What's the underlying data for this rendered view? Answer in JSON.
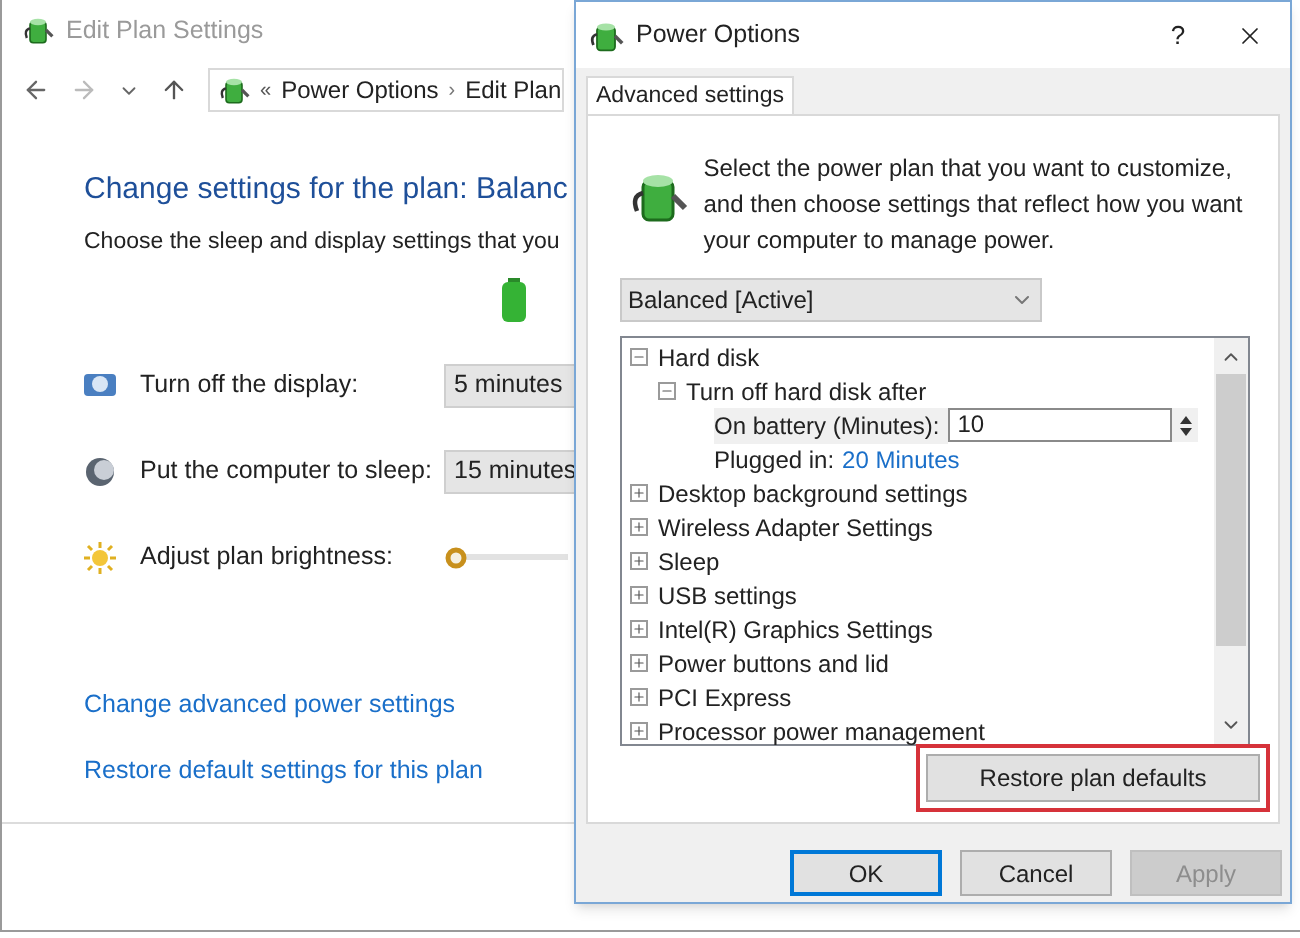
{
  "back_window": {
    "title": "Edit Plan Settings",
    "overflow": "«",
    "separator": "›",
    "breadcrumb": [
      "Power Options",
      "Edit Plan"
    ],
    "heading": "Change settings for the plan: Balanc",
    "subtitle": "Choose the sleep and display settings that you",
    "settings": [
      {
        "kind": "select",
        "label": "Turn off the display:",
        "value": "5 minutes"
      },
      {
        "kind": "select",
        "label": "Put the computer to sleep:",
        "value": "15 minutes"
      },
      {
        "kind": "slider",
        "label": "Adjust plan brightness:",
        "level": 0
      }
    ],
    "links": [
      "Change advanced power settings",
      "Restore default settings for this plan"
    ]
  },
  "dialog": {
    "title": "Power Options",
    "help": "?",
    "tabs": [
      {
        "label": "Advanced settings",
        "selected": true
      }
    ],
    "intro": "Select the power plan that you want to customize, and then choose settings that reflect how you want your computer to manage power.",
    "plan": "Balanced [Active]",
    "tree": [
      {
        "label": "Hard disk",
        "expanded": true,
        "children": [
          {
            "label": "Turn off hard disk after",
            "expanded": true,
            "children": [
              {
                "kind": "spin",
                "label": "On battery (Minutes):",
                "value": "10"
              },
              {
                "kind": "value",
                "label": "Plugged in:",
                "value": "20 Minutes"
              }
            ]
          }
        ]
      },
      {
        "label": "Desktop background settings",
        "expanded": false
      },
      {
        "label": "Wireless Adapter Settings",
        "expanded": false
      },
      {
        "label": "Sleep",
        "expanded": false
      },
      {
        "label": "USB settings",
        "expanded": false
      },
      {
        "label": "Intel(R) Graphics Settings",
        "expanded": false
      },
      {
        "label": "Power buttons and lid",
        "expanded": false
      },
      {
        "label": "PCI Express",
        "expanded": false
      },
      {
        "label": "Processor power management",
        "expanded": false
      }
    ],
    "restore_button": "Restore plan defaults",
    "buttons": [
      {
        "label": "OK",
        "disabled": false,
        "default": true
      },
      {
        "label": "Cancel",
        "disabled": false,
        "default": false
      },
      {
        "label": "Apply",
        "disabled": true,
        "default": false
      }
    ]
  }
}
